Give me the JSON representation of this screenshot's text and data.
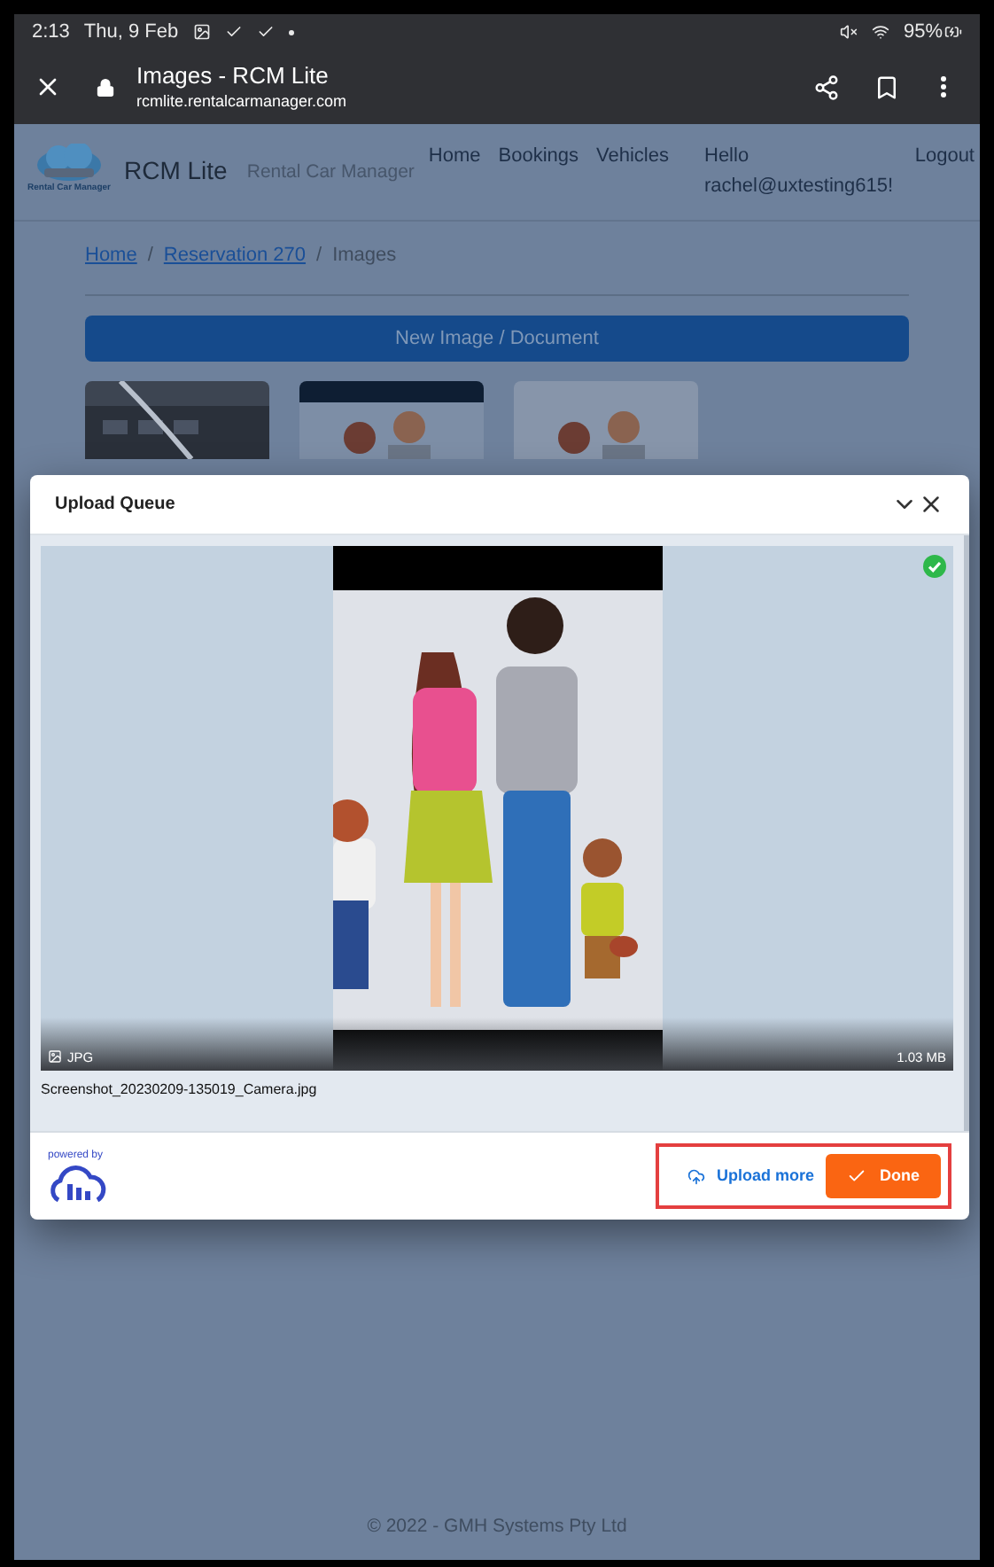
{
  "status_bar": {
    "time": "2:13",
    "date": "Thu, 9 Feb",
    "battery": "95%"
  },
  "browser": {
    "title": "Images - RCM Lite",
    "url": "rcmlite.rentalcarmanager.com"
  },
  "header": {
    "logo_text": "Rental Car Manager",
    "brand": "RCM Lite",
    "tagline": "Rental Car Manager",
    "nav": [
      "Home",
      "Bookings",
      "Vehicles"
    ],
    "greeting": "Hello",
    "user": "rachel@uxtesting615!",
    "logout": "Logout"
  },
  "breadcrumb": [
    {
      "label": "Home",
      "link": true
    },
    {
      "label": "Reservation 270",
      "link": true
    },
    {
      "label": "Images",
      "link": false
    }
  ],
  "breadcrumb_separators": [
    "/",
    "/"
  ],
  "new_button": "New Image / Document",
  "thumbnails": [
    {
      "kind": "picture"
    },
    {
      "kind": "picture"
    },
    {
      "kind": "picture"
    }
  ],
  "modal": {
    "title": "Upload Queue",
    "file": {
      "type": "JPG",
      "size": "1.03 MB",
      "name": "Screenshot_20230209-135019_Camera.jpg",
      "uploaded": true
    },
    "powered_by": "powered by",
    "upload_more": "Upload more",
    "done": "Done",
    "actions_highlighted": true
  },
  "footer": "© 2022 - GMH Systems Pty Ltd"
}
